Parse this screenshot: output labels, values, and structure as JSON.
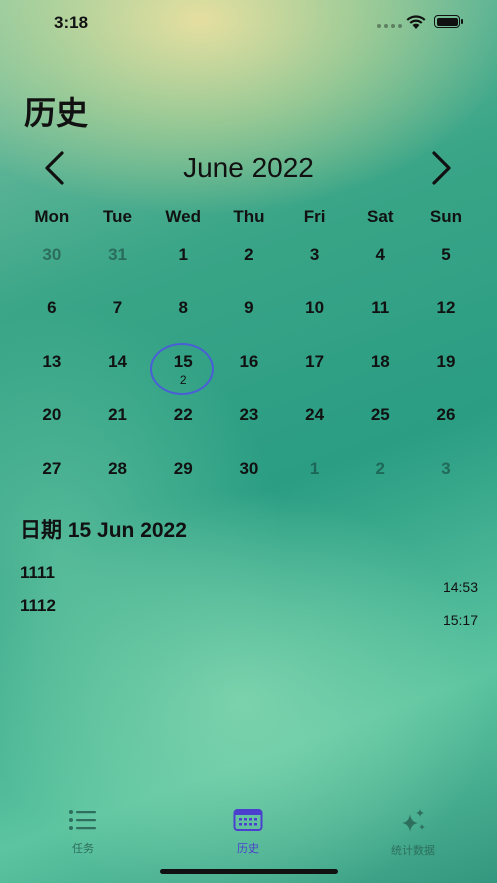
{
  "status_bar": {
    "time": "3:18"
  },
  "page": {
    "title": "历史"
  },
  "calendar": {
    "month_label": "June 2022",
    "weekdays": [
      "Mon",
      "Tue",
      "Wed",
      "Thu",
      "Fri",
      "Sat",
      "Sun"
    ],
    "weeks": [
      [
        {
          "d": "30",
          "other": true
        },
        {
          "d": "31",
          "other": true
        },
        {
          "d": "1"
        },
        {
          "d": "2"
        },
        {
          "d": "3"
        },
        {
          "d": "4"
        },
        {
          "d": "5"
        }
      ],
      [
        {
          "d": "6"
        },
        {
          "d": "7"
        },
        {
          "d": "8"
        },
        {
          "d": "9"
        },
        {
          "d": "10"
        },
        {
          "d": "11"
        },
        {
          "d": "12"
        }
      ],
      [
        {
          "d": "13"
        },
        {
          "d": "14"
        },
        {
          "d": "15",
          "selected": true,
          "count": "2"
        },
        {
          "d": "16"
        },
        {
          "d": "17"
        },
        {
          "d": "18"
        },
        {
          "d": "19"
        }
      ],
      [
        {
          "d": "20"
        },
        {
          "d": "21"
        },
        {
          "d": "22"
        },
        {
          "d": "23"
        },
        {
          "d": "24"
        },
        {
          "d": "25"
        },
        {
          "d": "26"
        }
      ],
      [
        {
          "d": "27"
        },
        {
          "d": "28"
        },
        {
          "d": "29"
        },
        {
          "d": "30"
        },
        {
          "d": "1",
          "other": true
        },
        {
          "d": "2",
          "other": true
        },
        {
          "d": "3",
          "other": true
        }
      ]
    ]
  },
  "selected_date": {
    "heading": "日期 15 Jun 2022"
  },
  "entries": [
    {
      "title": "1111",
      "time": "14:53"
    },
    {
      "title": "1112",
      "time": "15:17"
    }
  ],
  "tabs": [
    {
      "label": "任务",
      "icon": "list-icon"
    },
    {
      "label": "历史",
      "icon": "calendar-icon",
      "active": true
    },
    {
      "label": "统计数据",
      "icon": "sparkles-icon"
    }
  ],
  "colors": {
    "accent": "#4b3fcf",
    "selected_ring": "#4a5fd6",
    "tab_inactive": "#2d6f5c"
  }
}
